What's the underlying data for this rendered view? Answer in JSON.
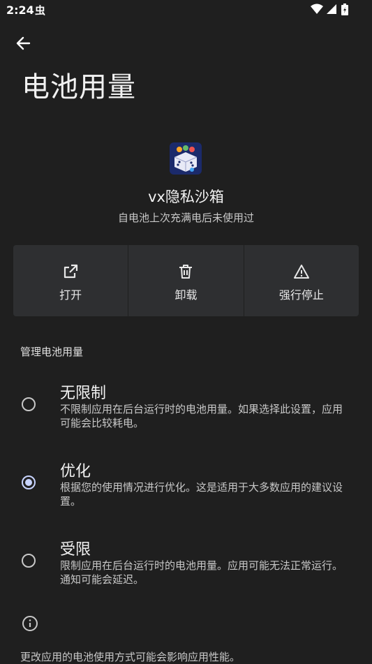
{
  "status_bar": {
    "time": "2:24",
    "notification": "虫",
    "icons": [
      "wifi-icon",
      "signal-icon",
      "battery-icon"
    ]
  },
  "header": {
    "back_icon": "arrow-left-icon",
    "title": "电池用量"
  },
  "app": {
    "icon": "app-dice-icon",
    "name": "vx隐私沙箱",
    "subtitle": "自电池上次充满电后未使用过"
  },
  "actions": [
    {
      "label": "打开",
      "icon": "open-external-icon"
    },
    {
      "label": "卸载",
      "icon": "trash-icon"
    },
    {
      "label": "强行停止",
      "icon": "warning-icon"
    }
  ],
  "section": {
    "title": "管理电池用量"
  },
  "options": [
    {
      "title": "无限制",
      "description": "不限制应用在后台运行时的电池用量。如果选择此设置，应用可能会比较耗电。",
      "selected": false
    },
    {
      "title": "优化",
      "description": "根据您的使用情况进行优化。这是适用于大多数应用的建议设置。",
      "selected": true
    },
    {
      "title": "受限",
      "description": "限制应用在后台运行时的电池用量。应用可能无法正常运行。通知可能会延迟。",
      "selected": false
    }
  ],
  "footer": {
    "info_icon": "info-icon",
    "text": "更改应用的电池使用方式可能会影响应用性能。"
  },
  "colors": {
    "background": "#1f1f1f",
    "surface": "#2e2f31",
    "accent": "#c8d4ff",
    "text_primary": "#f2f2f2",
    "text_secondary": "#c8c8c8"
  }
}
